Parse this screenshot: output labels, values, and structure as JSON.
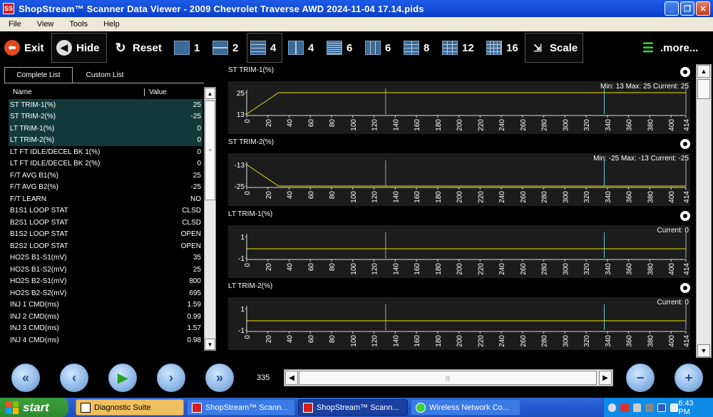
{
  "window": {
    "title": "ShopStream™ Scanner Data Viewer - 2009 Chevrolet Traverse  AWD  2024-11-04 17.14.pids",
    "controls": [
      "_",
      "❐",
      "✕"
    ]
  },
  "menu": [
    "File",
    "View",
    "Tools",
    "Help"
  ],
  "toolbar": {
    "exit": "Exit",
    "hide": "Hide",
    "reset": "Reset",
    "layouts": [
      "1",
      "2",
      "4",
      "4",
      "6",
      "6",
      "8",
      "12",
      "16"
    ],
    "scale": "Scale",
    "more": ".more..."
  },
  "left_panel": {
    "tabs": [
      "Complete List",
      "Custom List"
    ],
    "col_name": "Name",
    "col_value": "Value",
    "rows": [
      {
        "name": "ST TRIM-1(%)",
        "value": "25",
        "selected": true
      },
      {
        "name": "ST TRIM-2(%)",
        "value": "-25",
        "selected": true
      },
      {
        "name": "LT TRIM-1(%)",
        "value": "0",
        "selected": true
      },
      {
        "name": "LT TRIM-2(%)",
        "value": "0",
        "selected": true
      },
      {
        "name": "LT FT IDLE/DECEL BK 1(%)",
        "value": "0",
        "selected": false
      },
      {
        "name": "LT FT IDLE/DECEL BK 2(%)",
        "value": "0",
        "selected": false
      },
      {
        "name": "F/T AVG B1(%)",
        "value": "25",
        "selected": false
      },
      {
        "name": "F/T AVG B2(%)",
        "value": "-25",
        "selected": false
      },
      {
        "name": "F/T LEARN",
        "value": "NO",
        "selected": false
      },
      {
        "name": "B1S1 LOOP STAT",
        "value": "CLSD",
        "selected": false
      },
      {
        "name": "B2S1 LOOP STAT",
        "value": "CLSD",
        "selected": false
      },
      {
        "name": "B1S2 LOOP STAT",
        "value": "OPEN",
        "selected": false
      },
      {
        "name": "B2S2 LOOP STAT",
        "value": "OPEN",
        "selected": false
      },
      {
        "name": "HO2S B1-S1(mV)",
        "value": "35",
        "selected": false
      },
      {
        "name": "HO2S B1-S2(mV)",
        "value": "25",
        "selected": false
      },
      {
        "name": "HO2S B2-S1(mV)",
        "value": "800",
        "selected": false
      },
      {
        "name": "HO2S B2-S2(mV)",
        "value": "695",
        "selected": false
      },
      {
        "name": "INJ 1 CMD(ms)",
        "value": "1.59",
        "selected": false
      },
      {
        "name": "INJ 2 CMD(ms)",
        "value": "0.99",
        "selected": false
      },
      {
        "name": "INJ 3 CMD(ms)",
        "value": "1.57",
        "selected": false
      },
      {
        "name": "INJ 4 CMD(ms)",
        "value": "0.98",
        "selected": false
      }
    ]
  },
  "graphs": [
    {
      "title": "ST TRIM-1(%)",
      "stats": "Min: 13    Max: 25    Current: 25",
      "yticks": [
        "25",
        "13"
      ]
    },
    {
      "title": "ST TRIM-2(%)",
      "stats": "Min: -25    Max: -13    Current: -25",
      "yticks": [
        "-13",
        "-25"
      ]
    },
    {
      "title": "LT TRIM-1(%)",
      "stats": "Current: 0",
      "yticks": [
        "1",
        "-1"
      ]
    },
    {
      "title": "LT TRIM-2(%)",
      "stats": "Current: 0",
      "yticks": [
        "1",
        "-1"
      ]
    }
  ],
  "chart_data": [
    {
      "type": "line",
      "title": "ST TRIM-1(%)",
      "ylim": [
        13,
        25
      ],
      "xlim": [
        0,
        414
      ],
      "x": [
        0,
        5,
        10,
        15,
        20,
        25,
        30,
        414
      ],
      "y": [
        13,
        15,
        17,
        19,
        21,
        23,
        25,
        25
      ],
      "xticks": [
        0,
        20,
        40,
        60,
        80,
        100,
        120,
        140,
        160,
        180,
        200,
        220,
        240,
        260,
        280,
        300,
        320,
        340,
        360,
        380,
        400,
        414
      ],
      "cursors": [
        131,
        337,
        414
      ],
      "cursor_colors": [
        "#aaaaaa",
        "#5fd3d3",
        "#aaaaaa"
      ]
    },
    {
      "type": "line",
      "title": "ST TRIM-2(%)",
      "ylim": [
        -25,
        -13
      ],
      "xlim": [
        0,
        414
      ],
      "x": [
        0,
        5,
        10,
        15,
        20,
        25,
        30,
        414
      ],
      "y": [
        -13,
        -15,
        -17,
        -19,
        -21,
        -23,
        -25,
        -25
      ],
      "xticks": [
        0,
        20,
        40,
        60,
        80,
        100,
        120,
        140,
        160,
        180,
        200,
        220,
        240,
        260,
        280,
        300,
        320,
        340,
        360,
        380,
        400,
        414
      ],
      "cursors": [
        131,
        337,
        414
      ],
      "cursor_colors": [
        "#aaaaaa",
        "#5fd3d3",
        "#aaaaaa"
      ]
    },
    {
      "type": "line",
      "title": "LT TRIM-1(%)",
      "ylim": [
        -1,
        1
      ],
      "xlim": [
        0,
        414
      ],
      "x": [
        0,
        414
      ],
      "y": [
        0,
        0
      ],
      "xticks": [
        0,
        20,
        40,
        60,
        80,
        100,
        120,
        140,
        160,
        180,
        200,
        220,
        240,
        260,
        280,
        300,
        320,
        340,
        360,
        380,
        400,
        414
      ],
      "cursors": [
        131,
        337,
        414
      ],
      "cursor_colors": [
        "#aaaaaa",
        "#5fd3d3",
        "#aaaaaa"
      ]
    },
    {
      "type": "line",
      "title": "LT TRIM-2(%)",
      "ylim": [
        -1,
        1
      ],
      "xlim": [
        0,
        414
      ],
      "x": [
        0,
        414
      ],
      "y": [
        0,
        0
      ],
      "xticks": [
        0,
        20,
        40,
        60,
        80,
        100,
        120,
        140,
        160,
        180,
        200,
        220,
        240,
        260,
        280,
        300,
        320,
        340,
        360,
        380,
        400,
        414
      ],
      "cursors": [
        131,
        337,
        414
      ],
      "cursor_colors": [
        "#aaaaaa",
        "#5fd3d3",
        "#aaaaaa"
      ]
    }
  ],
  "line_color": "#e6e600",
  "bottom": {
    "frame": "335"
  },
  "taskbar": {
    "start": "start",
    "tasks": [
      "Diagnostic Suite",
      "ShopStream™ Scann...",
      "ShopStream™ Scann...",
      "Wireless Network Co..."
    ],
    "clock": "6:43 PM"
  }
}
